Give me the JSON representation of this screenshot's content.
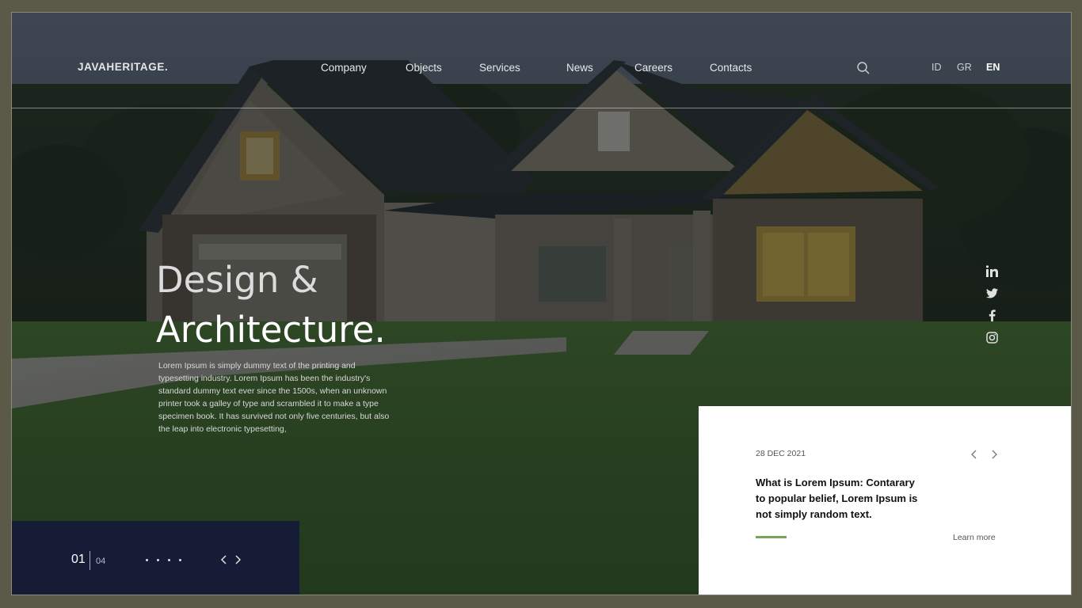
{
  "header": {
    "logo": "JAVAHERITAGE.",
    "nav": [
      {
        "label": "Company"
      },
      {
        "label": "Objects"
      },
      {
        "label": "Services"
      },
      {
        "label": "News"
      },
      {
        "label": "Careers"
      },
      {
        "label": "Contacts"
      }
    ],
    "search_icon": "search-icon",
    "languages": [
      {
        "label": "ID",
        "active": false
      },
      {
        "label": "GR",
        "active": false
      },
      {
        "label": "EN",
        "active": true
      }
    ]
  },
  "hero": {
    "title_line1": "Design &",
    "title_line2": "Architecture.",
    "text": "Lorem Ipsum is simply dummy text of the printing and typesetting industry. Lorem Ipsum has been the industry's standard dummy text ever since the 1500s, when an unknown printer took a galley of type and scrambled it to make a type specimen book. It has survived not only five centuries, but also the leap into electronic typesetting,"
  },
  "social": [
    "linkedin-icon",
    "twitter-icon",
    "facebook-icon",
    "instagram-icon"
  ],
  "slider": {
    "current": "01",
    "total": "04",
    "dot_count": 4,
    "prev_icon": "chevron-left-icon",
    "next_icon": "chevron-right-icon"
  },
  "news_card": {
    "date": "28 DEC 2021",
    "title": "What is Lorem Ipsum: Contarary to popular belief, Lorem Ipsum is not simply random text.",
    "learn_more": "Learn more",
    "accent_color": "#7aa35a"
  },
  "colors": {
    "page_border": "#5b5a49",
    "slider_bg": "#161c36",
    "card_bg": "#ffffff"
  }
}
